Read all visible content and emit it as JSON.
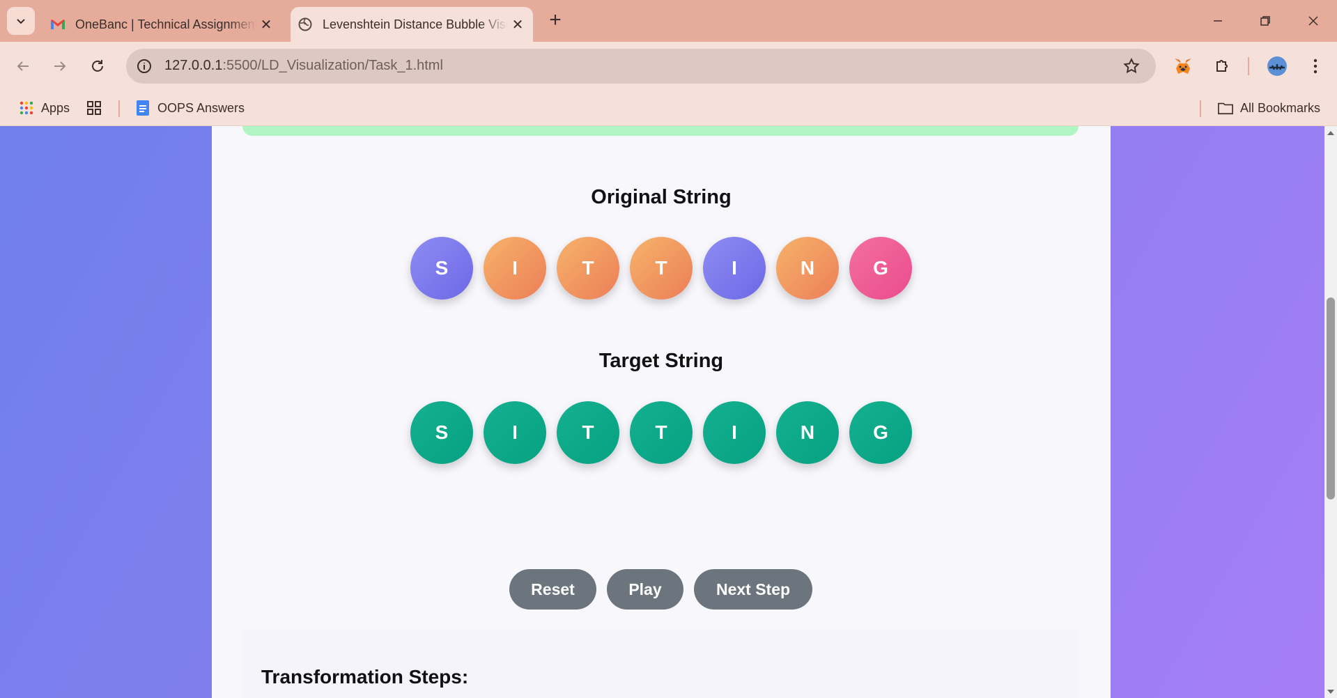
{
  "browser": {
    "tabs": [
      {
        "title": "OneBanc | Technical Assignment",
        "active": false
      },
      {
        "title": "Levenshtein Distance Bubble Visualization",
        "active": true
      }
    ],
    "url_host": "127.0.0.1",
    "url_path": ":5500/LD_Visualization/Task_1.html",
    "bookmarks": {
      "apps": "Apps",
      "oops": "OOPS Answers",
      "all": "All Bookmarks"
    }
  },
  "page": {
    "original": {
      "title": "Original String",
      "letters": [
        "S",
        "I",
        "T",
        "T",
        "I",
        "N",
        "G"
      ],
      "states": [
        "purple",
        "orange",
        "orange",
        "orange",
        "purple",
        "orange",
        "pink"
      ]
    },
    "target": {
      "title": "Target String",
      "letters": [
        "S",
        "I",
        "T",
        "T",
        "I",
        "N",
        "G"
      ],
      "states": [
        "green",
        "green",
        "green",
        "green",
        "green",
        "green",
        "green"
      ]
    },
    "controls": {
      "reset": "Reset",
      "play": "Play",
      "next": "Next Step"
    },
    "steps_title": "Transformation Steps:"
  },
  "colors": {
    "purple": "#7b77ec",
    "orange": "#f09a60",
    "pink": "#ee5c96",
    "green": "#0aa887",
    "button": "#6c757d"
  }
}
